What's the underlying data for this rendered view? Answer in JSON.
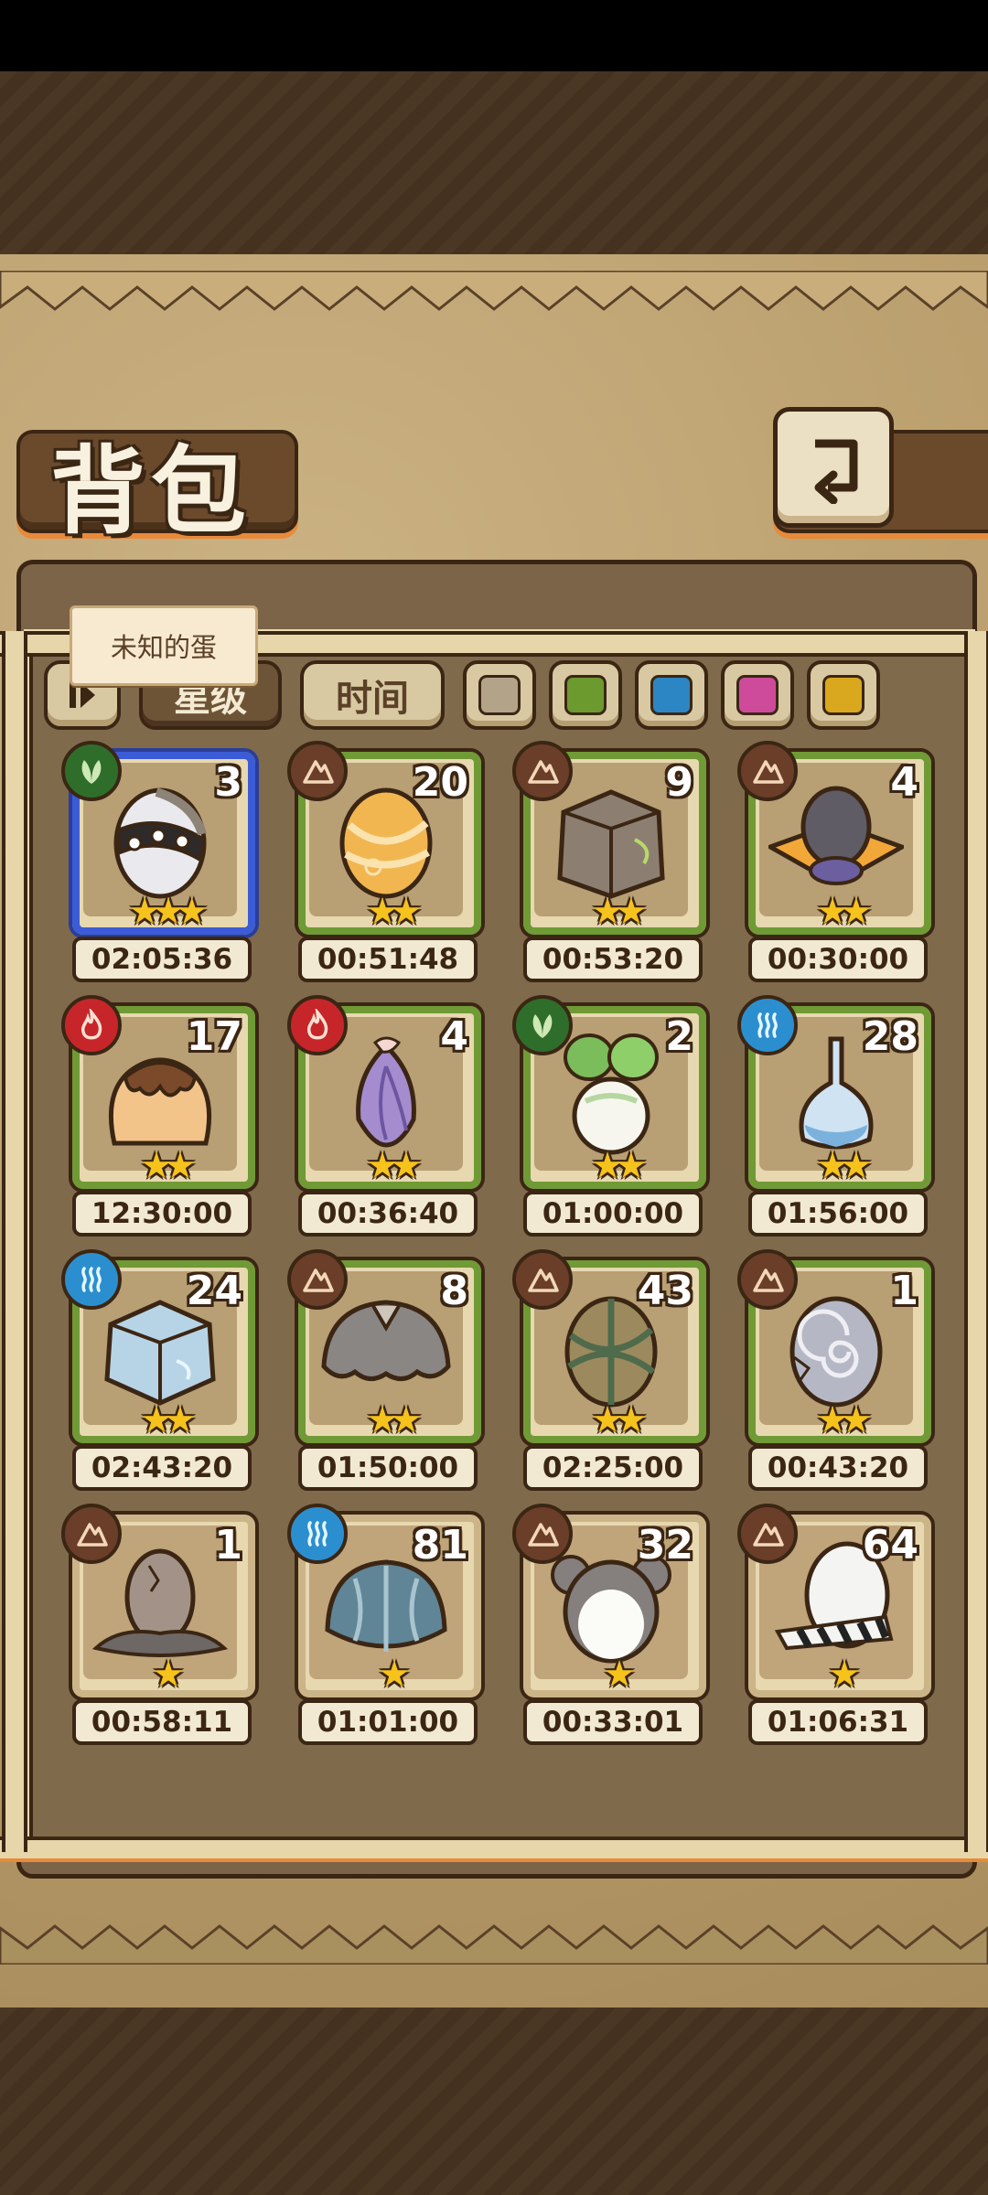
{
  "header": {
    "title": "背包"
  },
  "tooltip": "未知的蛋",
  "toolbar": {
    "sort_star_label": "星级",
    "sort_time_label": "时间",
    "swatches": [
      {
        "name": "neutral",
        "color": "#b3a389"
      },
      {
        "name": "green",
        "color": "#6c9a2e"
      },
      {
        "name": "blue",
        "color": "#2c86c4"
      },
      {
        "name": "pink",
        "color": "#cd4b9a"
      },
      {
        "name": "yellow",
        "color": "#d9a81e"
      }
    ]
  },
  "eggs": [
    {
      "count": "3",
      "time": "02:05:36",
      "stars": "★★★",
      "element": "grass",
      "border": "selected",
      "egg": "spiked-white"
    },
    {
      "count": "20",
      "time": "00:51:48",
      "stars": "★★",
      "element": "earth",
      "border": "green",
      "egg": "orange-swirl"
    },
    {
      "count": "9",
      "time": "00:53:20",
      "stars": "★★",
      "element": "earth",
      "border": "green",
      "egg": "stone-block"
    },
    {
      "count": "4",
      "time": "00:30:00",
      "stars": "★★",
      "element": "earth",
      "border": "green",
      "egg": "dark-hat"
    },
    {
      "count": "17",
      "time": "12:30:00",
      "stars": "★★",
      "element": "fire",
      "border": "green",
      "egg": "pudding"
    },
    {
      "count": "4",
      "time": "00:36:40",
      "stars": "★★",
      "element": "fire",
      "border": "green",
      "egg": "purple-flower"
    },
    {
      "count": "2",
      "time": "01:00:00",
      "stars": "★★",
      "element": "grass",
      "border": "green",
      "egg": "turnip"
    },
    {
      "count": "28",
      "time": "01:56:00",
      "stars": "★★",
      "element": "water",
      "border": "green",
      "egg": "glass-flask"
    },
    {
      "count": "24",
      "time": "02:43:20",
      "stars": "★★",
      "element": "water",
      "border": "green",
      "egg": "ice-block"
    },
    {
      "count": "8",
      "time": "01:50:00",
      "stars": "★★",
      "element": "earth",
      "border": "green",
      "egg": "grey-mushroom"
    },
    {
      "count": "43",
      "time": "02:25:00",
      "stars": "★★",
      "element": "earth",
      "border": "green",
      "egg": "wrapped-brown"
    },
    {
      "count": "1",
      "time": "00:43:20",
      "stars": "★★",
      "element": "earth",
      "border": "green",
      "egg": "spiral-grey"
    },
    {
      "count": "1",
      "time": "00:58:11",
      "stars": "★",
      "element": "earth",
      "border": "tan",
      "egg": "cracked-rock"
    },
    {
      "count": "81",
      "time": "01:01:00",
      "stars": "★",
      "element": "water",
      "border": "tan",
      "egg": "shell"
    },
    {
      "count": "32",
      "time": "00:33:01",
      "stars": "★",
      "element": "earth",
      "border": "tan",
      "egg": "koala"
    },
    {
      "count": "64",
      "time": "01:06:31",
      "stars": "★",
      "element": "earth",
      "border": "tan",
      "egg": "zebra"
    }
  ]
}
